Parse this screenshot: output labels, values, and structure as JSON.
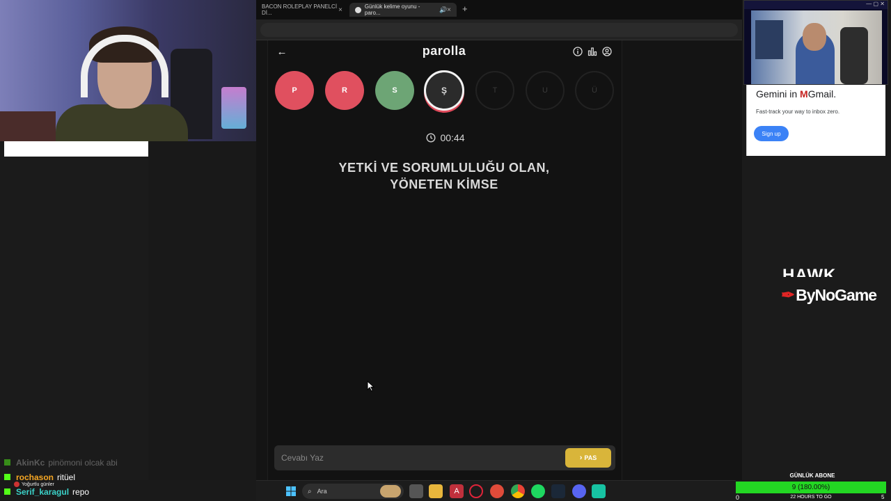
{
  "browser": {
    "tabs": [
      {
        "label": "BACON ROLEPLAY PANELCİ Dİ...",
        "active": false
      },
      {
        "label": "Günlük kelime oyunu - paro...",
        "active": true
      }
    ],
    "new_tab": "+",
    "close_glyph": "×"
  },
  "game": {
    "logo": "parolla",
    "letters": [
      {
        "char": "P",
        "state": "wrong"
      },
      {
        "char": "R",
        "state": "wrong"
      },
      {
        "char": "S",
        "state": "right"
      },
      {
        "char": "Ş",
        "state": "current"
      },
      {
        "char": "T",
        "state": "pending"
      },
      {
        "char": "U",
        "state": "pending"
      },
      {
        "char": "Ü",
        "state": "pending"
      }
    ],
    "timer": "00:44",
    "question_line1": "YETKİ VE SORUMLULUĞU OLAN,",
    "question_line2": "YÖNETEN KİMSE",
    "answer_placeholder": "Cevabı Yaz",
    "pass_label": "PAS",
    "colors": {
      "wrong": "#e0505f",
      "right": "#6da575",
      "pass": "#d9b53a"
    }
  },
  "ad": {
    "title_prefix": "Gemini in ",
    "title_m": "M",
    "title_suffix": "Gmail.",
    "subtitle": "Fast-track your way to inbox zero.",
    "button": "Sign up"
  },
  "sponsor": {
    "top_text": "HAWK",
    "name": "ByNoGame"
  },
  "goal": {
    "label": "GÜNLÜK ABONE",
    "progress": "9 (180.00%)",
    "start": "0",
    "end": "5",
    "remaining": "22 HOURS TO GO",
    "accent": "#23d723"
  },
  "chat": [
    {
      "user": "AkinKc",
      "text": "pinömoni olcak abi",
      "user_color": "#9a9a9a",
      "faded": true
    },
    {
      "user": "rochason",
      "text": "ritüel",
      "user_color": "#f5a623",
      "faded": false
    },
    {
      "user": "Serif_karagul",
      "text": "repo",
      "user_color": "#3bd1c8",
      "faded": false
    }
  ],
  "sub_tag": "Yoğurtlu günler",
  "taskbar": {
    "search_label": "Ara",
    "icons": [
      "windows-icon",
      "task-view-icon",
      "file-explorer-icon",
      "app-a-icon",
      "opera-icon",
      "app-red-icon",
      "chrome-icon",
      "spotify-icon",
      "steam-icon",
      "discord-icon",
      "app-green-icon"
    ]
  }
}
